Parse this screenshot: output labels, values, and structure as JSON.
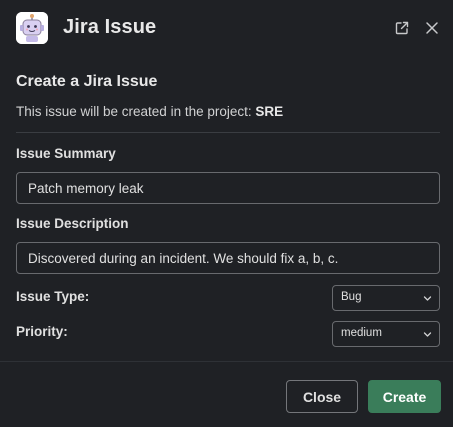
{
  "header": {
    "title": "Jira Issue",
    "app_icon": "robot-avatar-icon",
    "popout_icon": "external-link-icon",
    "close_icon": "close-icon"
  },
  "form": {
    "section_title": "Create a Jira Issue",
    "project_prefix": "This issue will be created in the project: ",
    "project_name": "SRE",
    "summary": {
      "label": "Issue Summary",
      "value": "Patch memory leak"
    },
    "description": {
      "label": "Issue Description",
      "value": "Discovered during an incident. We should fix a, b, c."
    },
    "issue_type": {
      "label": "Issue Type:",
      "selected": "Bug"
    },
    "priority": {
      "label": "Priority:",
      "selected": "medium"
    }
  },
  "footer": {
    "close_label": "Close",
    "create_label": "Create"
  },
  "colors": {
    "background": "#1f2125",
    "primary_button": "#3a7d5a",
    "text": "#d1d2d3"
  }
}
